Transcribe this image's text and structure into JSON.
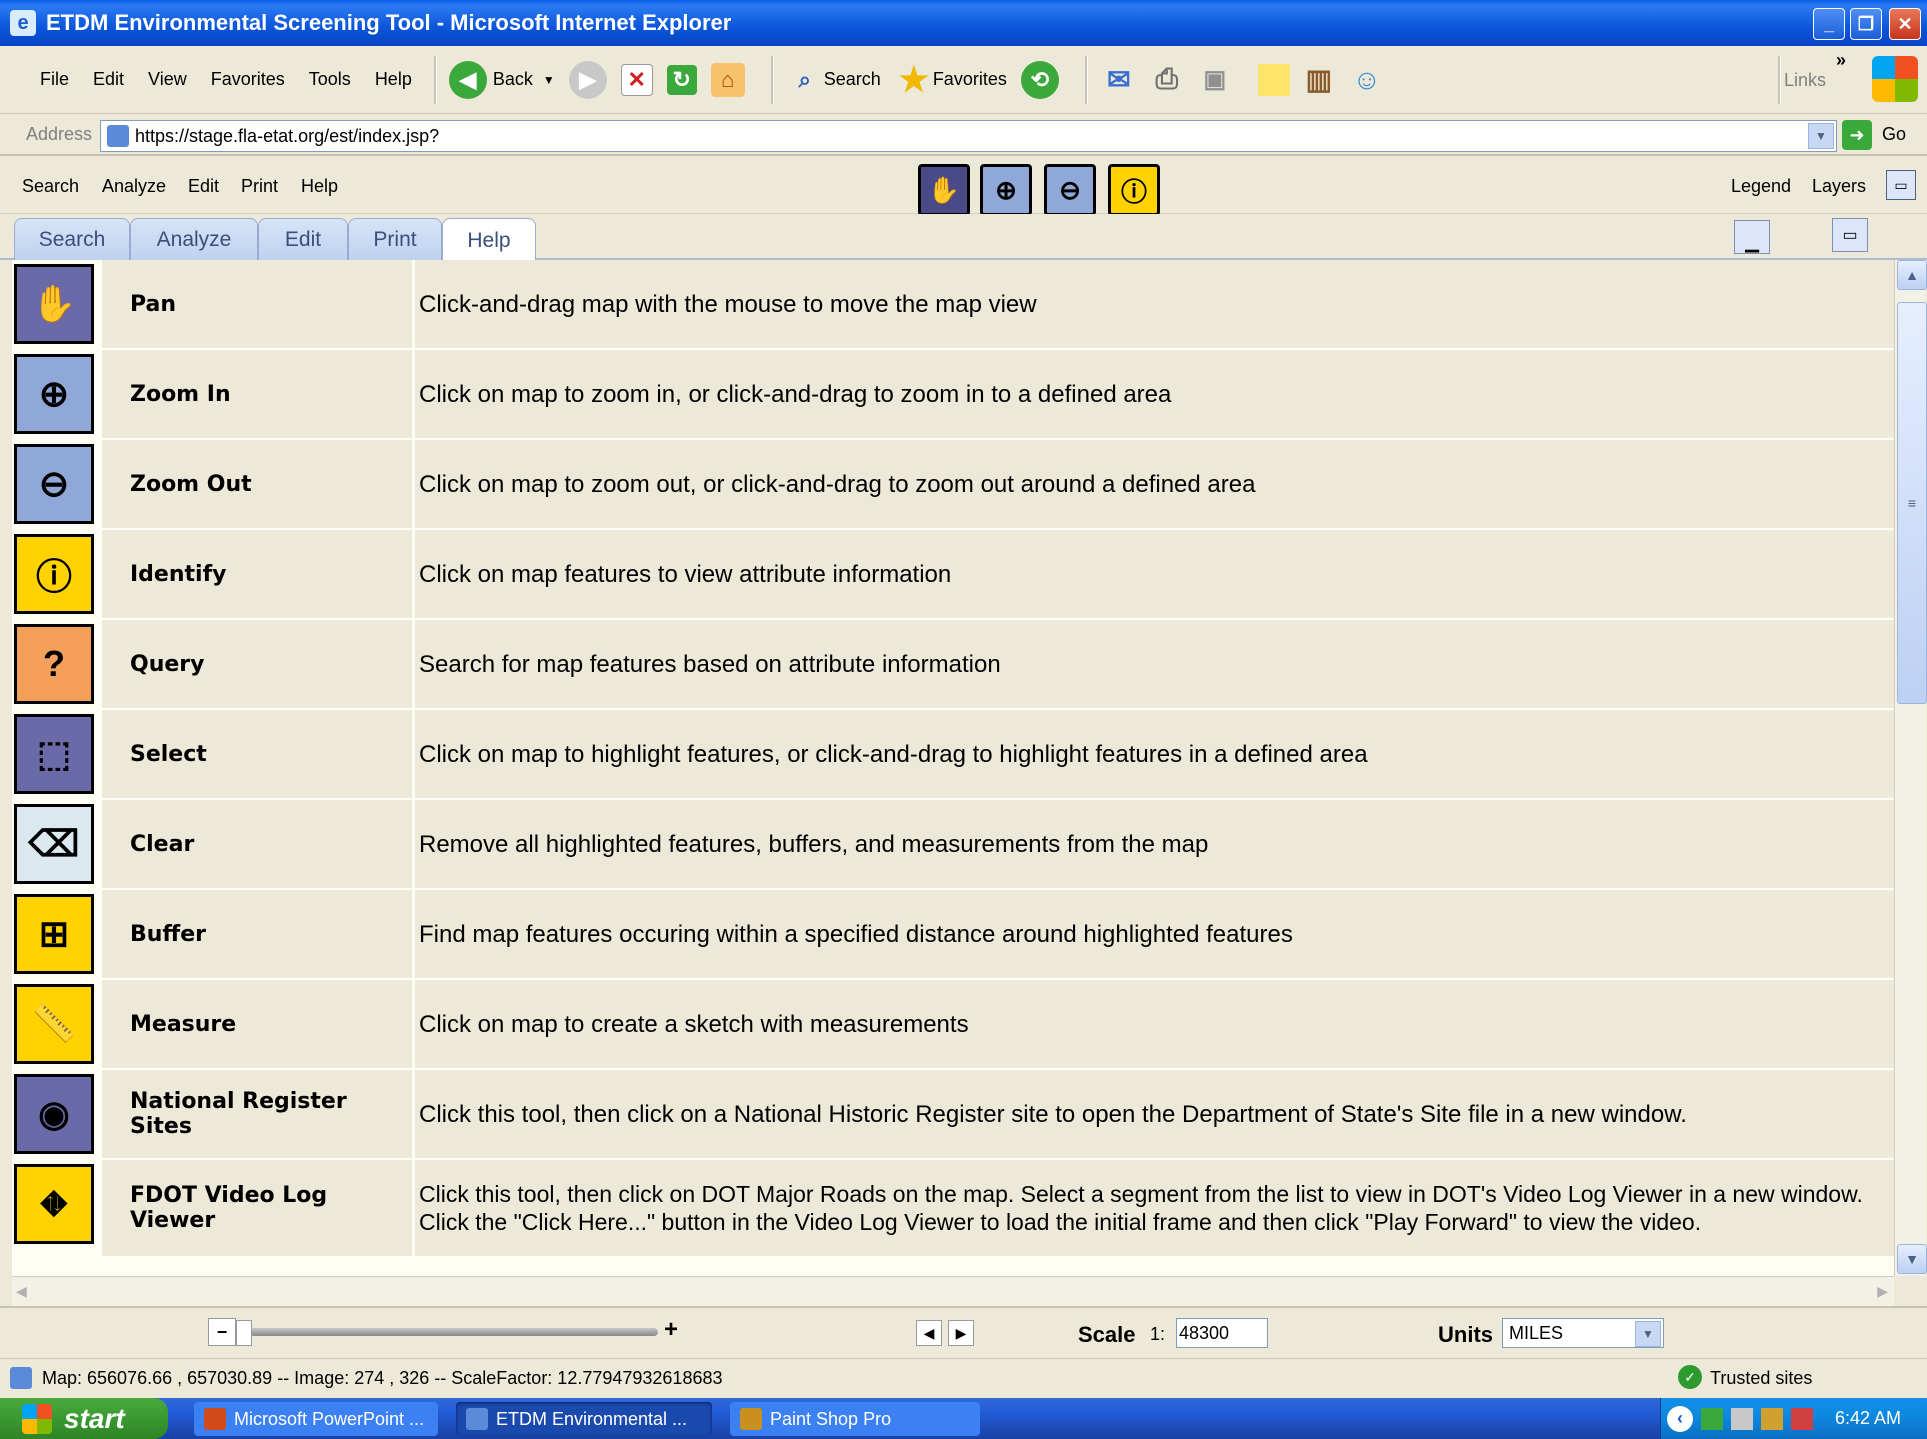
{
  "window": {
    "title": "ETDM Environmental Screening Tool - Microsoft Internet Explorer"
  },
  "menu": [
    "File",
    "Edit",
    "View",
    "Favorites",
    "Tools",
    "Help"
  ],
  "toolbar": {
    "back": "Back",
    "search": "Search",
    "favorites": "Favorites",
    "links": "Links"
  },
  "address": {
    "label": "Address",
    "url": "https://stage.fla-etat.org/est/index.jsp?",
    "go": "Go"
  },
  "app_menu": [
    "Search",
    "Analyze",
    "Edit",
    "Print",
    "Help"
  ],
  "app_right": {
    "legend": "Legend",
    "layers": "Layers"
  },
  "tabs": [
    "Search",
    "Analyze",
    "Edit",
    "Print",
    "Help"
  ],
  "help_rows": [
    {
      "name": "Pan",
      "desc": "Click-and-drag map with the mouse to move the map view",
      "icon": "hand-icon",
      "color": "#6a6aa8"
    },
    {
      "name": "Zoom In",
      "desc": "Click on map to zoom in, or click-and-drag to zoom in to a defined area",
      "icon": "zoom-in-icon",
      "color": "#8fa8d8"
    },
    {
      "name": "Zoom Out",
      "desc": "Click on map to zoom out, or click-and-drag to zoom out around a defined area",
      "icon": "zoom-out-icon",
      "color": "#8fa8d8"
    },
    {
      "name": "Identify",
      "desc": "Click on map features to view attribute information",
      "icon": "info-icon",
      "color": "#ffd200"
    },
    {
      "name": "Query",
      "desc": "Search for map features based on attribute information",
      "icon": "query-icon",
      "color": "#f4a05a"
    },
    {
      "name": "Select",
      "desc": "Click on map to highlight features, or click-and-drag to highlight features in a defined area",
      "icon": "select-icon",
      "color": "#6a6aa8"
    },
    {
      "name": "Clear",
      "desc": "Remove all highlighted features, buffers, and measurements from the map",
      "icon": "eraser-icon",
      "color": "#dce8f0"
    },
    {
      "name": "Buffer",
      "desc": "Find map features occuring within a specified distance around highlighted features",
      "icon": "buffer-icon",
      "color": "#ffd200"
    },
    {
      "name": "Measure",
      "desc": "Click on map to create a sketch with measurements",
      "icon": "ruler-icon",
      "color": "#ffd200"
    },
    {
      "name": "National Register Sites",
      "desc": "Click this tool, then click on a National Historic Register site to open the Department of State's Site file in a new window.",
      "icon": "camera-icon",
      "color": "#6a6aa8"
    },
    {
      "name": "FDOT Video Log Viewer",
      "desc": "Click this tool, then click on DOT Major Roads on the map. Select a segment from the list to view in DOT's Video Log Viewer in a new window. Click the \"Click Here...\" button in the Video Log Viewer to load the initial frame and then click \"Play Forward\" to view the video.",
      "icon": "road-icon",
      "color": "#ffd200"
    }
  ],
  "map": {
    "scale_label": "Scale",
    "scale_prefix": "1:",
    "scale_value": "48300",
    "units_label": "Units",
    "units_value": "MILES"
  },
  "status": {
    "text": "Map: 656076.66 , 657030.89 -- Image: 274 , 326 -- ScaleFactor: 12.77947932618683",
    "zone": "Trusted sites"
  },
  "taskbar": {
    "start": "start",
    "items": [
      "Microsoft PowerPoint ...",
      "ETDM Environmental ...",
      "Paint Shop Pro"
    ],
    "clock": "6:42 AM"
  }
}
